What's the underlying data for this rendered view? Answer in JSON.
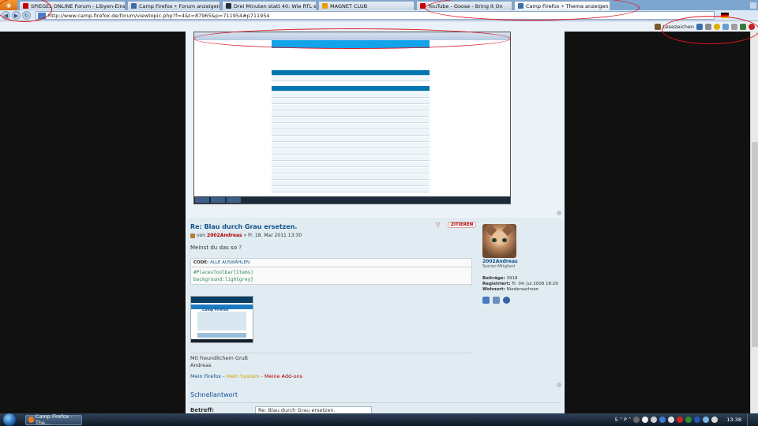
{
  "browser": {
    "menu_button": "Firefox",
    "tabs": [
      {
        "label": "SPIEGEL ONLINE Forum - Libyen-Eins...",
        "icon": "spiegel-icon",
        "color": "#c00000",
        "active": false
      },
      {
        "label": "Camp Firefox • Forum anzeigen - Fire...",
        "icon": "camp-firefox-icon",
        "color": "#3d6ea8",
        "active": false
      },
      {
        "label": "Drei Minuten statt 40: Wie RTL ein Int...",
        "icon": "news-icon",
        "color": "#203040",
        "active": false
      },
      {
        "label": "MAGNET CLUB",
        "icon": "magnet-icon",
        "color": "#e5a000",
        "active": false
      },
      {
        "label": "YouTube - Goose - Bring It On",
        "icon": "youtube-icon",
        "color": "#d00000",
        "active": false
      },
      {
        "label": "Camp Firefox • Thema anzeigen - Bla...",
        "icon": "camp-firefox-icon",
        "color": "#3d6ea8",
        "active": true
      }
    ],
    "url": "http://www.camp-firefox.de/forum/viewtopic.php?f=4&t=87965&p=711954#p711954",
    "bookmarks_label": "Lesezeichen"
  },
  "post": {
    "title": "Re: Blau durch Grau ersetzen.",
    "by": "von",
    "author": "2002Andreas",
    "date": "» Fr. 18. Mar 2011 13:30",
    "quote_button": "ZITIEREN",
    "text_before": "Meinst du das so ",
    "text_q": "?",
    "code_header_label": "CODE:",
    "code_select_all": "ALLE AUSWÄHLEN",
    "code_lines": [
      "#PlacesToolbar[Items]",
      "background:lightgrey}"
    ],
    "thumb_label": "Camp Firefox",
    "greeting_1": "Mit freundlichem Gruß",
    "greeting_2": "Andreas",
    "sig_link_1": "Mein Firefox",
    "sig_sep_1": " - ",
    "sig_link_2": "Mein System",
    "sig_sep_2": " - ",
    "sig_link_3": "Meine Add-ons"
  },
  "profile": {
    "name": "2002Andreas",
    "rank": "Senior-Mitglied",
    "posts_label": "Beiträge:",
    "posts_value": "3918",
    "registered_label": "Registriert:",
    "registered_value": "Fr. 04. Jul 2008 18:29",
    "location_label": "Wohnort:",
    "location_value": "Niedersachsen"
  },
  "quick_reply": {
    "title": "Schnellantwort",
    "subject_label": "Betreff:",
    "subject_value": "Re: Blau durch Grau ersetzen."
  },
  "taskbar": {
    "task_label": "Camp Firefox - The...",
    "tray_text": "5 ˄ P ˄",
    "clock": "13:38"
  },
  "colors": {
    "annotation": "#e0141e",
    "forum_bg": "#ecf3f7",
    "post_bg": "#e1ebf2",
    "link_blue": "#105289",
    "author_red": "#aa0000"
  }
}
